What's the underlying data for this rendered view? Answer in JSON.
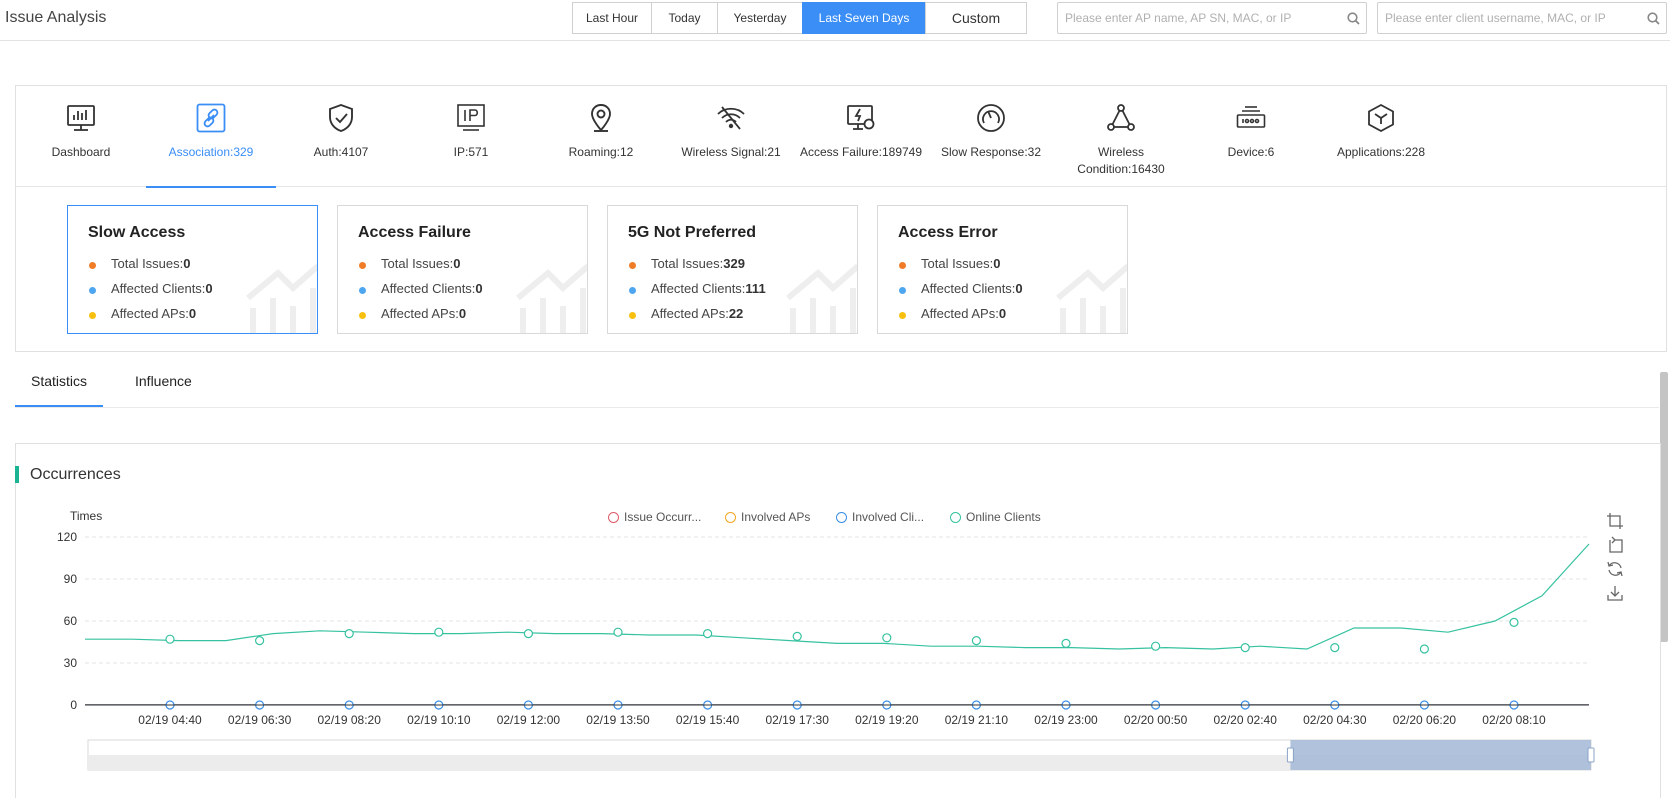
{
  "header": {
    "title": "Issue Analysis",
    "ranges": [
      {
        "label": "Last Hour",
        "active": false
      },
      {
        "label": "Today",
        "active": false
      },
      {
        "label": "Yesterday",
        "active": false
      },
      {
        "label": "Last Seven Days",
        "active": true
      },
      {
        "label": "Custom",
        "active": false
      }
    ],
    "ap_search_placeholder": "Please enter AP name, AP SN, MAC, or IP",
    "client_search_placeholder": "Please enter client username, MAC, or IP",
    "search_icon": "magnifier-icon"
  },
  "categories": [
    {
      "label": "Dashboard",
      "icon": "dashboard-icon",
      "active": false
    },
    {
      "label": "Association:329",
      "icon": "link-icon",
      "active": true
    },
    {
      "label": "Auth:4107",
      "icon": "shield-check-icon",
      "active": false
    },
    {
      "label": "IP:571",
      "icon": "ip-icon",
      "active": false
    },
    {
      "label": "Roaming:12",
      "icon": "location-pin-icon",
      "active": false
    },
    {
      "label": "Wireless Signal:21",
      "icon": "wifi-off-icon",
      "active": false
    },
    {
      "label": "Access Failure:189749",
      "icon": "monitor-bolt-icon",
      "active": false
    },
    {
      "label": "Slow Response:32",
      "icon": "gauge-icon",
      "active": false
    },
    {
      "label": "Wireless Condition:16430",
      "icon": "network-triangle-icon",
      "active": false
    },
    {
      "label": "Device:6",
      "icon": "router-icon",
      "active": false
    },
    {
      "label": "Applications:228",
      "icon": "hexagon-icon",
      "active": false
    }
  ],
  "cards": [
    {
      "title": "Slow Access",
      "total_label": "Total Issues:",
      "total": "0",
      "clients_label": "Affected Clients:",
      "clients": "0",
      "aps_label": "Affected APs:",
      "aps": "0",
      "active": true
    },
    {
      "title": "Access Failure",
      "total_label": "Total Issues:",
      "total": "0",
      "clients_label": "Affected Clients:",
      "clients": "0",
      "aps_label": "Affected APs:",
      "aps": "0",
      "active": false
    },
    {
      "title": "5G Not Preferred",
      "total_label": "Total Issues:",
      "total": "329",
      "clients_label": "Affected Clients:",
      "clients": "111",
      "aps_label": "Affected APs:",
      "aps": "22",
      "active": false
    },
    {
      "title": "Access Error",
      "total_label": "Total Issues:",
      "total": "0",
      "clients_label": "Affected Clients:",
      "clients": "0",
      "aps_label": "Affected APs:",
      "aps": "0",
      "active": false
    }
  ],
  "stat_colors": {
    "total": "#f07c28",
    "clients": "#4ea6f0",
    "aps": "#f7c00f"
  },
  "tabs": [
    {
      "label": "Statistics",
      "active": true
    },
    {
      "label": "Influence",
      "active": false
    }
  ],
  "section_title": "Occurrences",
  "tools": [
    "zoom-area-icon",
    "zoom-reset-icon",
    "refresh-icon",
    "download-icon"
  ],
  "chart_data": {
    "type": "line",
    "ylabel": "Times",
    "ylim": [
      0,
      120
    ],
    "yticks": [
      0,
      30,
      60,
      90,
      120
    ],
    "xticks": [
      "02/19 04:40",
      "02/19 06:30",
      "02/19 08:20",
      "02/19 10:10",
      "02/19 12:00",
      "02/19 13:50",
      "02/19 15:40",
      "02/19 17:30",
      "02/19 19:20",
      "02/19 21:10",
      "02/19 23:00",
      "02/20 00:50",
      "02/20 02:40",
      "02/20 04:30",
      "02/20 06:20",
      "02/20 08:10"
    ],
    "grid": true,
    "legend_position": "top-center",
    "series": [
      {
        "name": "Issue Occurr...",
        "color": "#e05a6b",
        "values": [
          0,
          0,
          0,
          0,
          0,
          0,
          0,
          0,
          0,
          0,
          0,
          0,
          0,
          0,
          0,
          0,
          0,
          0
        ]
      },
      {
        "name": "Involved APs",
        "color": "#f5a623",
        "values": [
          0,
          0,
          0,
          0,
          0,
          0,
          0,
          0,
          0,
          0,
          0,
          0,
          0,
          0,
          0,
          0,
          0,
          0
        ]
      },
      {
        "name": "Involved Cli...",
        "color": "#3a8ee6",
        "values": [
          0,
          0,
          0,
          0,
          0,
          0,
          0,
          0,
          0,
          0,
          0,
          0,
          0,
          0,
          0,
          0,
          0,
          0
        ]
      },
      {
        "name": "Online Clients",
        "color": "#36c2a0",
        "values": [
          47,
          47,
          46,
          46,
          51,
          53,
          52,
          51,
          51,
          52,
          51,
          51,
          50,
          50,
          48,
          46,
          44,
          44,
          42,
          42,
          41,
          41,
          40,
          41,
          40,
          42,
          40,
          55,
          55,
          52,
          60,
          78,
          115
        ]
      }
    ],
    "online_markers": [
      47,
      46,
      51,
      52,
      51,
      52,
      51,
      49,
      48,
      46,
      44,
      42,
      41,
      41,
      40,
      59
    ]
  },
  "slider": {
    "window_start_fraction": 0.8,
    "window_end_fraction": 1.0
  }
}
